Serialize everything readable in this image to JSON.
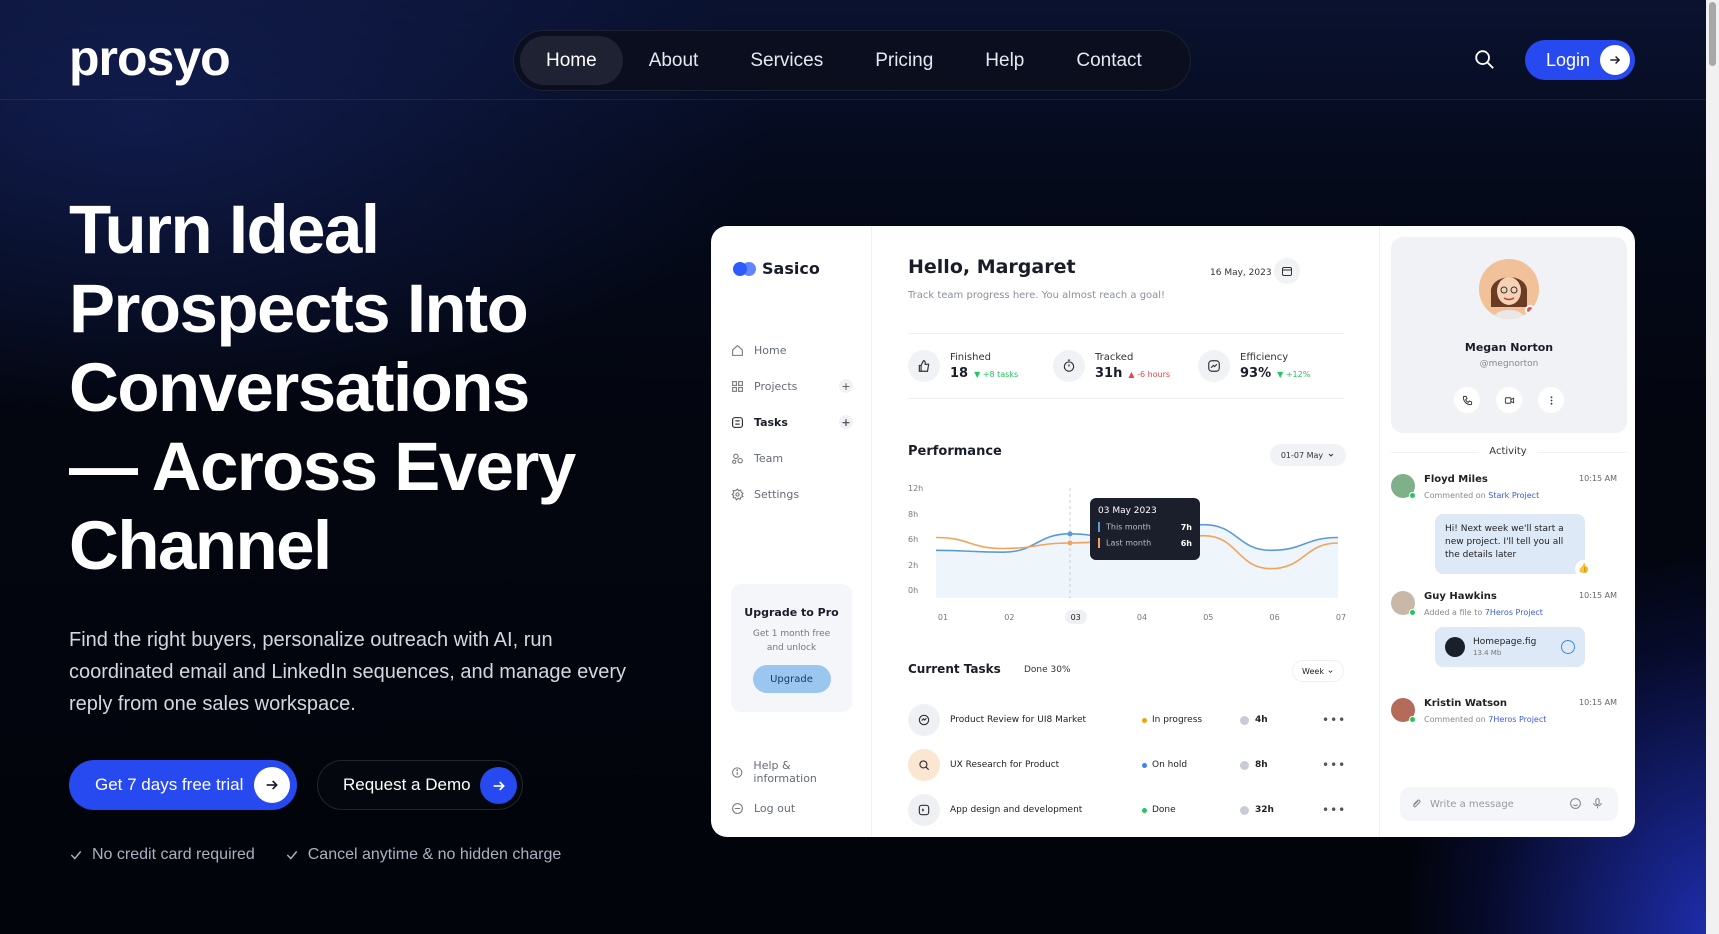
{
  "header": {
    "logo": "prosyo",
    "nav": [
      {
        "label": "Home",
        "active": true
      },
      {
        "label": "About"
      },
      {
        "label": "Services"
      },
      {
        "label": "Pricing"
      },
      {
        "label": "Help"
      },
      {
        "label": "Contact"
      }
    ],
    "login_label": "Login"
  },
  "hero": {
    "title_lines": [
      "Turn Ideal",
      "Prospects Into",
      "Conversations",
      "— Across Every",
      "Channel"
    ],
    "description": "Find the right buyers, personalize outreach with AI, run coordinated email and LinkedIn sequences, and manage every reply from one sales workspace.",
    "cta_primary": "Get 7 days free trial",
    "cta_secondary": "Request a Demo",
    "checks": [
      "No credit card required",
      "Cancel anytime & no hidden charge"
    ]
  },
  "dashboard": {
    "brand": "Sasico",
    "sidebar": [
      {
        "label": "Home",
        "icon": "home-icon"
      },
      {
        "label": "Projects",
        "icon": "grid-icon",
        "plus": "+"
      },
      {
        "label": "Tasks",
        "icon": "tasks-icon",
        "plus": "+",
        "active": true
      },
      {
        "label": "Team",
        "icon": "team-icon"
      },
      {
        "label": "Settings",
        "icon": "gear-icon"
      }
    ],
    "upgrade": {
      "title": "Upgrade to Pro",
      "subtitle": "Get 1 month free and unlock",
      "button": "Upgrade"
    },
    "sidebar_bottom": [
      {
        "label": "Help & information",
        "icon": "info-icon"
      },
      {
        "label": "Log out",
        "icon": "logout-icon"
      }
    ],
    "greeting": "Hello, Margaret",
    "greeting_sub": "Track team progress here. You almost reach a goal!",
    "date": "16 May, 2023",
    "stats": [
      {
        "label": "Finished",
        "value": "18",
        "change": "+8 tasks",
        "dir": "down",
        "color": "#22c55e"
      },
      {
        "label": "Tracked",
        "value": "31h",
        "change": "-6 hours",
        "dir": "up",
        "color": "#ef4444"
      },
      {
        "label": "Efficiency",
        "value": "93%",
        "change": "+12%",
        "dir": "down",
        "color": "#22c55e"
      }
    ],
    "performance": {
      "title": "Performance",
      "range": "01-07 May",
      "y_ticks": [
        "12h",
        "8h",
        "6h",
        "2h",
        "0h"
      ],
      "x_ticks": [
        "01",
        "02",
        "03",
        "04",
        "05",
        "06",
        "07"
      ],
      "selected_x": "03",
      "tooltip": {
        "date": "03 May 2023",
        "this_month_label": "This month",
        "this_month_value": "7h",
        "last_month_label": "Last month",
        "last_month_value": "6h"
      }
    },
    "chart_data": {
      "type": "line",
      "categories": [
        "01",
        "02",
        "03",
        "04",
        "05",
        "06",
        "07"
      ],
      "series": [
        {
          "name": "This month",
          "color": "#5b9bd5",
          "values": [
            5.2,
            5.0,
            7.0,
            6.0,
            8.0,
            5.2,
            6.6
          ]
        },
        {
          "name": "Last month",
          "color": "#f0a35e",
          "values": [
            6.6,
            5.4,
            6.0,
            6.4,
            6.8,
            3.2,
            6.0
          ]
        }
      ],
      "ylim": [
        0,
        12
      ],
      "y_ticks": [
        "12h",
        "8h",
        "6h",
        "2h",
        "0h"
      ]
    },
    "tasks": {
      "title": "Current Tasks",
      "done": "Done 30%",
      "filter": "Week",
      "rows": [
        {
          "name": "Product Review for UI8 Market",
          "status": "In progress",
          "status_color": "#f59e0b",
          "hours": "4h",
          "icon": "review-icon"
        },
        {
          "name": "UX Research for Product",
          "status": "On hold",
          "status_color": "#3b82f6",
          "hours": "8h",
          "icon": "research-icon"
        },
        {
          "name": "App design and development",
          "status": "Done",
          "status_color": "#22c55e",
          "hours": "32h",
          "icon": "code-icon"
        }
      ]
    },
    "profile": {
      "name": "Megan Norton",
      "handle": "@megnorton"
    },
    "activity": {
      "title": "Activity",
      "items": [
        {
          "name": "Floyd Miles",
          "time": "10:15 AM",
          "action": "Commented on",
          "target": "Stark Project",
          "message": "Hi! Next week we'll start a new project. I'll tell you all the details later",
          "avatar_color": "#7fb08a"
        },
        {
          "name": "Guy Hawkins",
          "time": "10:15 AM",
          "action": "Added a file to",
          "target": "7Heros Project",
          "file_name": "Homepage.fig",
          "file_size": "13.4 Mb",
          "avatar_color": "#c9b8a8"
        },
        {
          "name": "Kristin Watson",
          "time": "10:15 AM",
          "action": "Commented on",
          "target": "7Heros Project",
          "avatar_color": "#b56b5a"
        }
      ],
      "message_placeholder": "Write a message"
    }
  }
}
